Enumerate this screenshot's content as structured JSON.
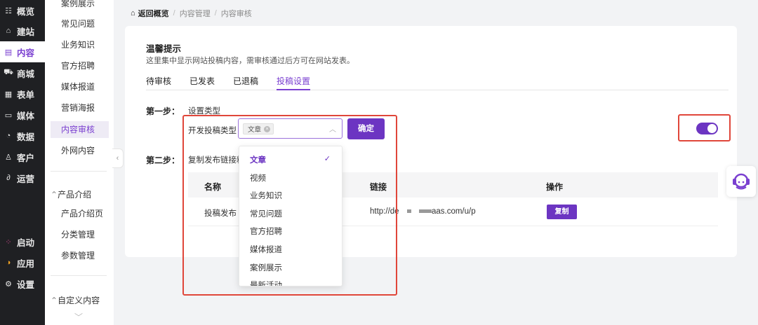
{
  "sidebar_main": [
    {
      "label": "概览",
      "icon": "overview-icon",
      "glyph": "☷"
    },
    {
      "label": "建站",
      "icon": "home-icon",
      "glyph": "⌂"
    },
    {
      "label": "内容",
      "icon": "document-icon",
      "glyph": "▤"
    },
    {
      "label": "商城",
      "icon": "cart-icon",
      "glyph": "⛟"
    },
    {
      "label": "表单",
      "icon": "form-icon",
      "glyph": "▦"
    },
    {
      "label": "媒体",
      "icon": "video-icon",
      "glyph": "▭"
    },
    {
      "label": "数据",
      "icon": "chart-icon",
      "glyph": "◔"
    },
    {
      "label": "客户",
      "icon": "user-icon",
      "glyph": "♙"
    },
    {
      "label": "运营",
      "icon": "link-icon",
      "glyph": "∂"
    },
    {
      "label": "启动",
      "icon": "launch-icon",
      "glyph": "⁘"
    },
    {
      "label": "应用",
      "icon": "apps-icon",
      "glyph": "◑"
    },
    {
      "label": "设置",
      "icon": "gear-icon",
      "glyph": "⚙"
    }
  ],
  "sidebar_sub": {
    "items_top": [
      "案例展示",
      "常见问题",
      "业务知识",
      "官方招聘",
      "媒体报道",
      "营销海报",
      "内容审核",
      "外网内容"
    ],
    "group_product": "产品介绍",
    "items_product": [
      "产品介绍页",
      "分类管理",
      "参数管理"
    ],
    "group_custom": "自定义内容"
  },
  "breadcrumb": {
    "back": "返回概览",
    "level1": "内容管理",
    "level2": "内容审核"
  },
  "tip": {
    "title": "温馨提示",
    "desc": "这里集中显示网站投稿内容，需审核通过后方可在网站发表。"
  },
  "tabs": [
    "待审核",
    "已发表",
    "已退稿",
    "投稿设置"
  ],
  "step1": {
    "label": "第一步：",
    "subtitle": "设置类型",
    "field_label": "开发投稿类型",
    "tag": "文章",
    "confirm": "确定"
  },
  "step2": {
    "label": "第二步：",
    "text": "复制发布链接粘"
  },
  "table": {
    "headers": {
      "name": "名称",
      "link": "链接",
      "action": "操作"
    },
    "row": {
      "name": "投稿发布",
      "link_prefix": "http://de",
      "link_suffix": "aas.com/u/p",
      "copy": "复制"
    }
  },
  "dropdown": {
    "options": [
      "文章",
      "视频",
      "业务知识",
      "常见问题",
      "官方招聘",
      "媒体报道",
      "案例展示",
      "最新活动"
    ],
    "selected": "文章"
  },
  "colors": {
    "accent": "#6c35c2",
    "annotation": "#e0463a",
    "sidebar": "#1f2023"
  }
}
